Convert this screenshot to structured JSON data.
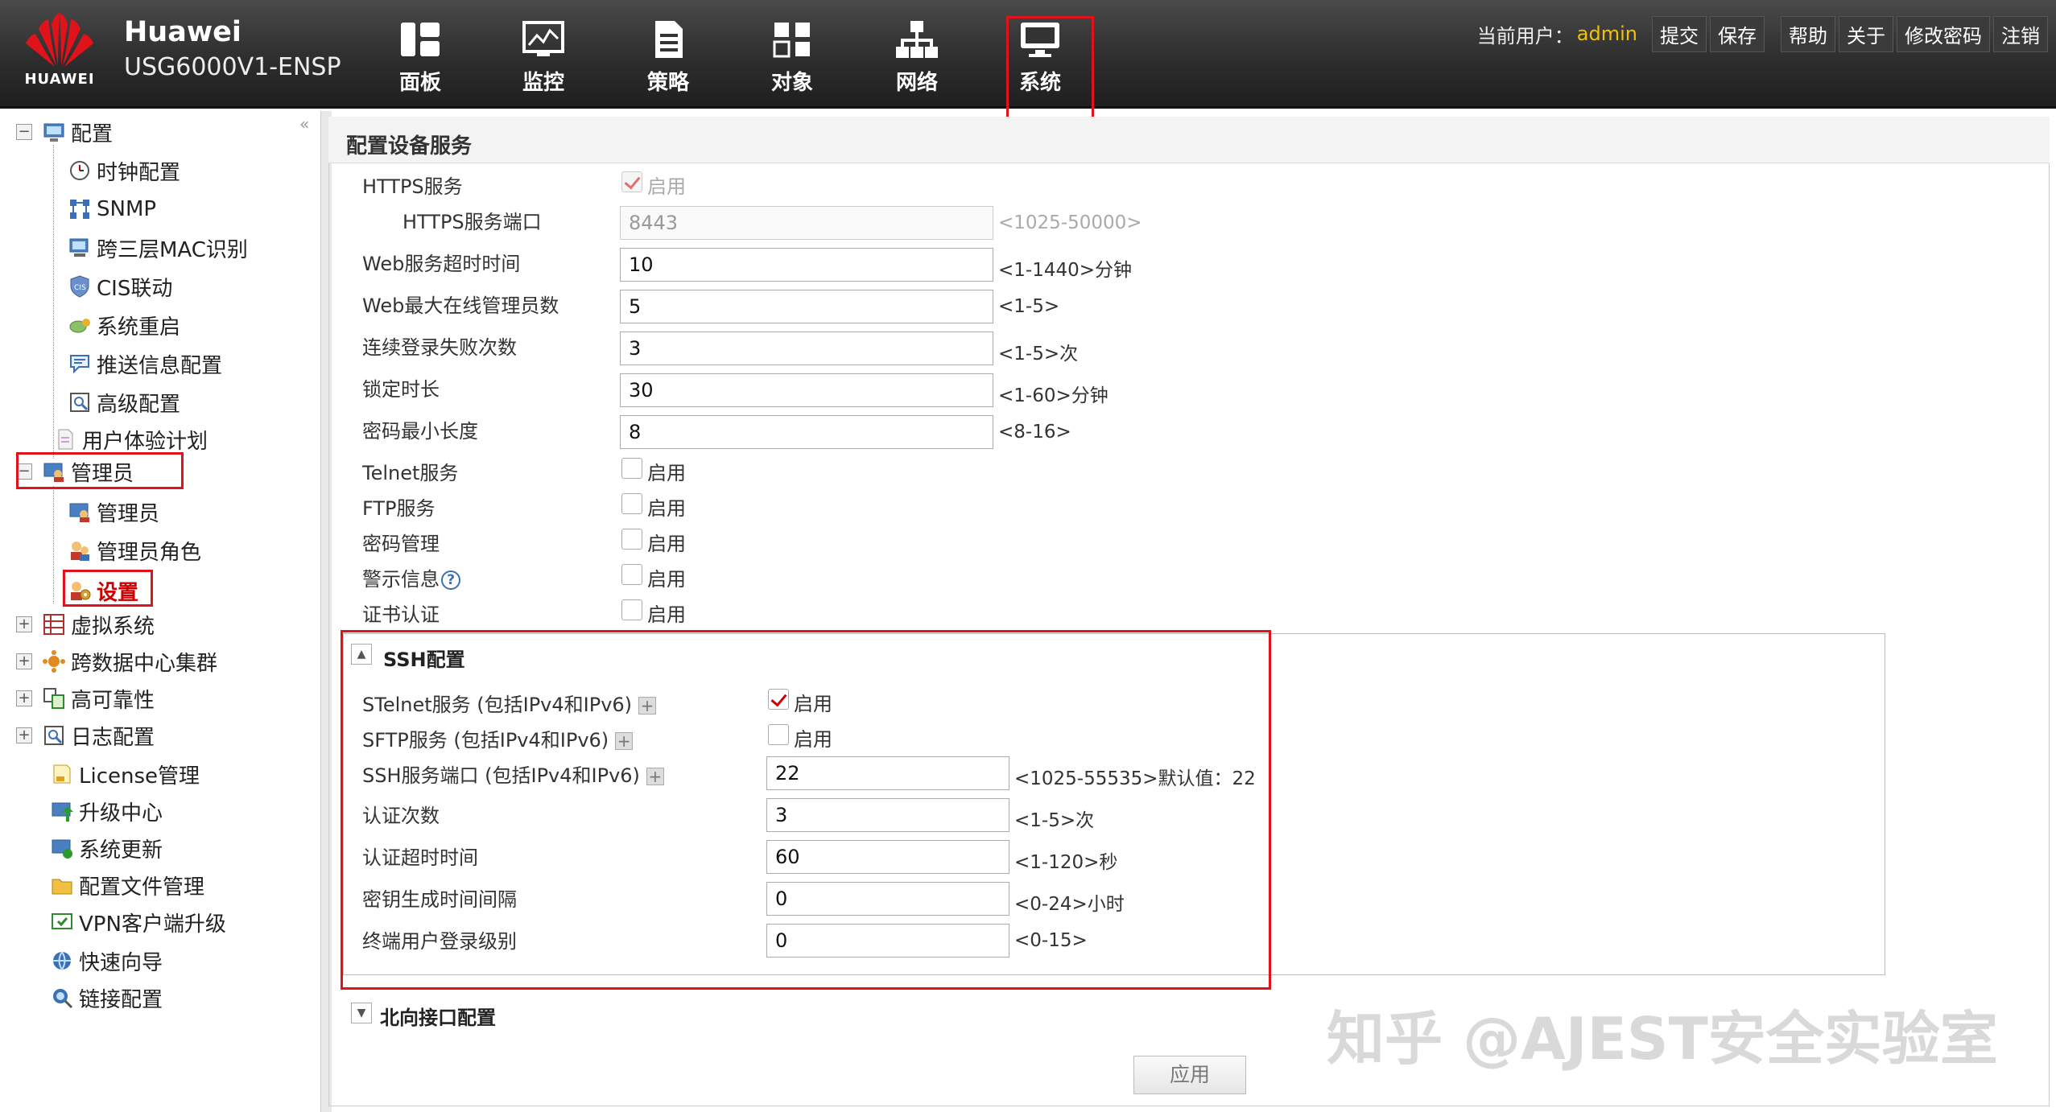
{
  "header": {
    "logo_text": "HUAWEI",
    "brand": "Huawei",
    "model": "USG6000V1-ENSP",
    "nav": [
      {
        "label": "面板",
        "icon": "dashboard-icon"
      },
      {
        "label": "监控",
        "icon": "monitor-icon"
      },
      {
        "label": "策略",
        "icon": "policy-icon"
      },
      {
        "label": "对象",
        "icon": "object-icon"
      },
      {
        "label": "网络",
        "icon": "network-icon"
      },
      {
        "label": "系统",
        "icon": "system-icon",
        "selected": true
      }
    ],
    "user_label": "当前用户：",
    "username": "admin",
    "actions": {
      "commit": "提交",
      "save": "保存",
      "help": "帮助",
      "about": "关于",
      "change_password": "修改密码",
      "logout": "注销"
    }
  },
  "sidebar": {
    "collapse_symbol": "«",
    "items": [
      {
        "label": "配置",
        "expanded": true
      },
      {
        "label": "时钟配置"
      },
      {
        "label": "SNMP"
      },
      {
        "label": "跨三层MAC识别"
      },
      {
        "label": "CIS联动"
      },
      {
        "label": "系统重启"
      },
      {
        "label": "推送信息配置"
      },
      {
        "label": "高级配置"
      },
      {
        "label": "用户体验计划"
      },
      {
        "label": "管理员",
        "expanded": true
      },
      {
        "label": "管理员"
      },
      {
        "label": "管理员角色"
      },
      {
        "label": "设置",
        "selected": true
      },
      {
        "label": "虚拟系统"
      },
      {
        "label": "跨数据中心集群"
      },
      {
        "label": "高可靠性"
      },
      {
        "label": "日志配置"
      },
      {
        "label": "License管理"
      },
      {
        "label": "升级中心"
      },
      {
        "label": "系统更新"
      },
      {
        "label": "配置文件管理"
      },
      {
        "label": "VPN客户端升级"
      },
      {
        "label": "快速向导"
      },
      {
        "label": "链接配置"
      }
    ],
    "expand_symbol": "+",
    "collapse_node_symbol": "−"
  },
  "main": {
    "title": "配置设备服务",
    "enable_label": "启用",
    "fields": {
      "https_service": {
        "label": "HTTPS服务",
        "checked": true,
        "disabled": true
      },
      "https_port": {
        "label": "HTTPS服务端口",
        "value": "8443",
        "hint": "<1025-50000>"
      },
      "web_timeout": {
        "label": "Web服务超时时间",
        "value": "10",
        "hint": "<1-1440>分钟"
      },
      "web_max_admins": {
        "label": "Web最大在线管理员数",
        "value": "5",
        "hint": "<1-5>"
      },
      "login_fail_count": {
        "label": "连续登录失败次数",
        "value": "3",
        "hint": "<1-5>次"
      },
      "lock_duration": {
        "label": "锁定时长",
        "value": "30",
        "hint": "<1-60>分钟"
      },
      "password_min_len": {
        "label": "密码最小长度",
        "value": "8",
        "hint": "<8-16>"
      },
      "telnet_service": {
        "label": "Telnet服务",
        "checked": false
      },
      "ftp_service": {
        "label": "FTP服务",
        "checked": false
      },
      "password_mgmt": {
        "label": "密码管理",
        "checked": false
      },
      "warning_info": {
        "label": "警示信息",
        "checked": false
      },
      "cert_auth": {
        "label": "证书认证",
        "checked": false
      }
    },
    "ssh": {
      "title": "SSH配置",
      "toggle_symbol": "▲",
      "stelnet": {
        "label": "STelnet服务 (包括IPv4和IPv6)",
        "checked": true
      },
      "sftp": {
        "label": "SFTP服务 (包括IPv4和IPv6)",
        "checked": false
      },
      "ssh_port": {
        "label": "SSH服务端口 (包括IPv4和IPv6)",
        "value": "22",
        "hint": "<1025-55535>默认值：22"
      },
      "auth_count": {
        "label": "认证次数",
        "value": "3",
        "hint": "<1-5>次"
      },
      "auth_timeout": {
        "label": "认证超时时间",
        "value": "60",
        "hint": "<1-120>秒"
      },
      "key_interval": {
        "label": "密钥生成时间间隔",
        "value": "0",
        "hint": "<0-24>小时"
      },
      "user_level": {
        "label": "终端用户登录级别",
        "value": "0",
        "hint": "<0-15>"
      }
    },
    "northbound": {
      "title": "北向接口配置",
      "toggle_symbol": "▼"
    },
    "apply_label": "应用",
    "help_symbol": "?",
    "plus_symbol": "+"
  },
  "watermark": "知乎 @AJEST安全实验室",
  "colors": {
    "highlight": "#e0121a",
    "topbar": "#2e2e2e",
    "username": "#f2c200",
    "check": "#cc0000"
  }
}
